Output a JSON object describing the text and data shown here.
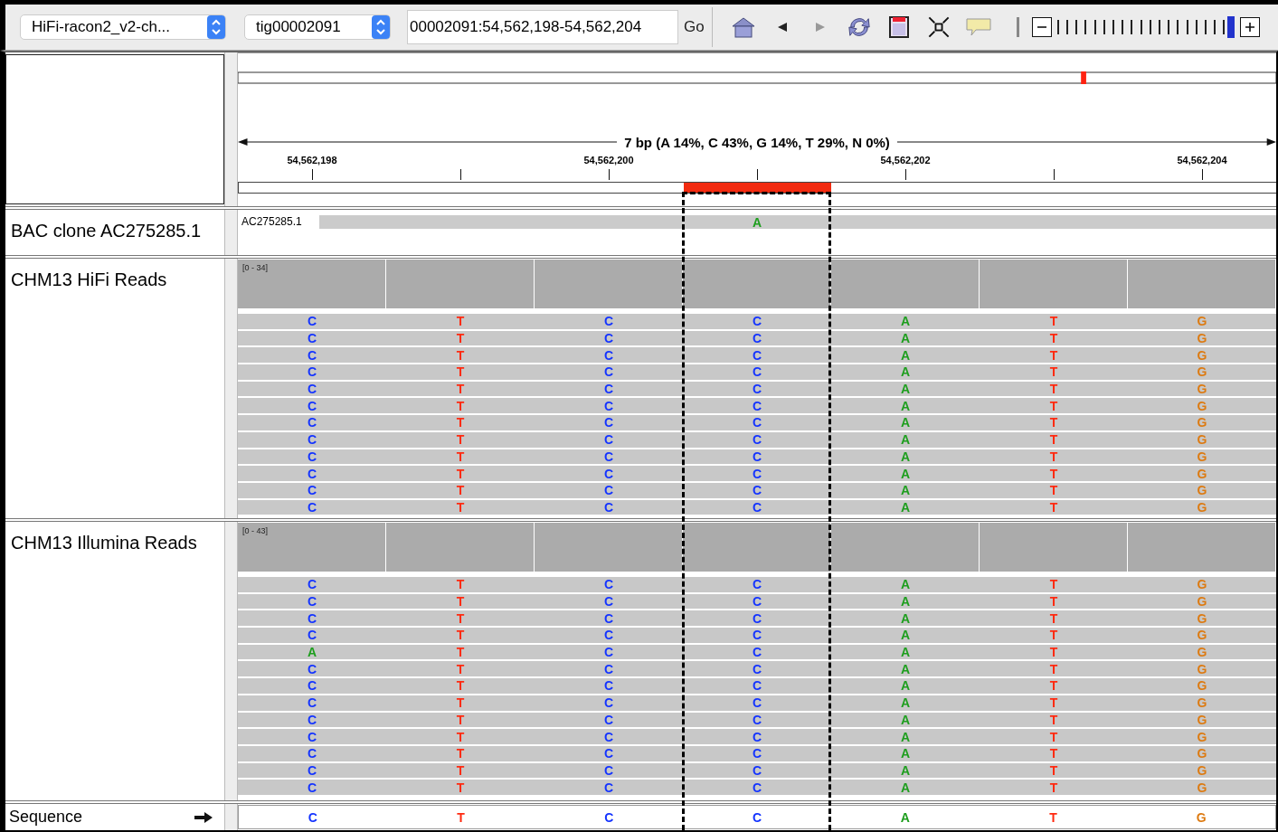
{
  "toolbar": {
    "genome": "HiFi-racon2_v2-ch...",
    "chromosome": "tig00002091",
    "locus": "00002091:54,562,198-54,562,204",
    "go": "Go",
    "zoom": {
      "level": 1
    }
  },
  "ruler": {
    "summary": "7 bp (A 14%, C 43%, G 14%, T 29%, N 0%)",
    "tick_labels": [
      "54,562,198",
      "54,562,200",
      "54,562,202",
      "54,562,204"
    ]
  },
  "bac_track": {
    "name": "BAC clone AC275285.1",
    "feature_label": "AC275285.1",
    "mismatch_base": "A"
  },
  "read_tracks": [
    {
      "name": "CHM13 HiFi Reads",
      "range": "[0 - 34]",
      "reads": [
        [
          "C",
          "T",
          "C",
          "C",
          "A",
          "T",
          "G"
        ],
        [
          "C",
          "T",
          "C",
          "C",
          "A",
          "T",
          "G"
        ],
        [
          "C",
          "T",
          "C",
          "C",
          "A",
          "T",
          "G"
        ],
        [
          "C",
          "T",
          "C",
          "C",
          "A",
          "T",
          "G"
        ],
        [
          "C",
          "T",
          "C",
          "C",
          "A",
          "T",
          "G"
        ],
        [
          "C",
          "T",
          "C",
          "C",
          "A",
          "T",
          "G"
        ],
        [
          "C",
          "T",
          "C",
          "C",
          "A",
          "T",
          "G"
        ],
        [
          "C",
          "T",
          "C",
          "C",
          "A",
          "T",
          "G"
        ],
        [
          "C",
          "T",
          "C",
          "C",
          "A",
          "T",
          "G"
        ],
        [
          "C",
          "T",
          "C",
          "C",
          "A",
          "T",
          "G"
        ],
        [
          "C",
          "T",
          "C",
          "C",
          "A",
          "T",
          "G"
        ],
        [
          "C",
          "T",
          "C",
          "C",
          "A",
          "T",
          "G"
        ]
      ]
    },
    {
      "name": "CHM13 Illumina Reads",
      "range": "[0 - 43]",
      "reads": [
        [
          "C",
          "T",
          "C",
          "C",
          "A",
          "T",
          "G"
        ],
        [
          "C",
          "T",
          "C",
          "C",
          "A",
          "T",
          "G"
        ],
        [
          "C",
          "T",
          "C",
          "C",
          "A",
          "T",
          "G"
        ],
        [
          "C",
          "T",
          "C",
          "C",
          "A",
          "T",
          "G"
        ],
        [
          "A",
          "T",
          "C",
          "C",
          "A",
          "T",
          "G"
        ],
        [
          "C",
          "T",
          "C",
          "C",
          "A",
          "T",
          "G"
        ],
        [
          "C",
          "T",
          "C",
          "C",
          "A",
          "T",
          "G"
        ],
        [
          "C",
          "T",
          "C",
          "C",
          "A",
          "T",
          "G"
        ],
        [
          "C",
          "T",
          "C",
          "C",
          "A",
          "T",
          "G"
        ],
        [
          "C",
          "T",
          "C",
          "C",
          "A",
          "T",
          "G"
        ],
        [
          "C",
          "T",
          "C",
          "C",
          "A",
          "T",
          "G"
        ],
        [
          "C",
          "T",
          "C",
          "C",
          "A",
          "T",
          "G"
        ],
        [
          "C",
          "T",
          "C",
          "C",
          "A",
          "T",
          "G"
        ]
      ]
    }
  ],
  "sequence": {
    "name": "Sequence",
    "bases": [
      {
        "base": "C",
        "selected": false
      },
      {
        "base": "T",
        "selected": false
      },
      {
        "base": "C",
        "selected": false
      },
      {
        "base": "C",
        "selected": true
      },
      {
        "base": "A",
        "selected": false
      },
      {
        "base": "T",
        "selected": false
      },
      {
        "base": "G",
        "selected": false
      }
    ]
  }
}
